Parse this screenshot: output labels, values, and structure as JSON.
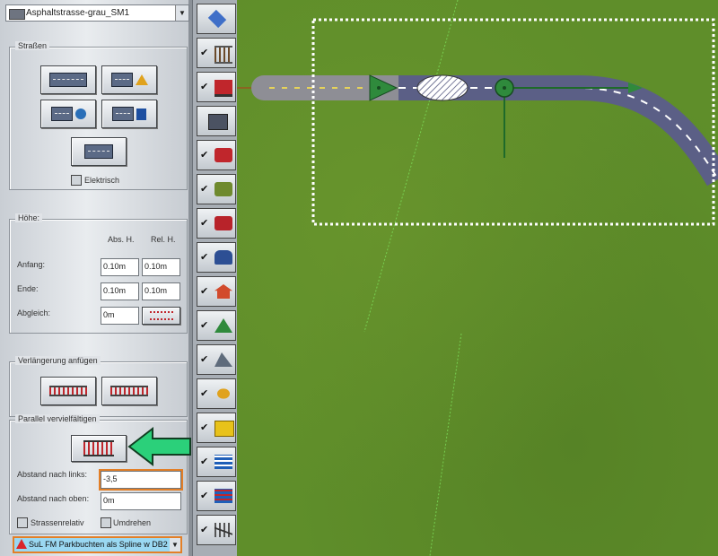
{
  "top_combo": {
    "value": "Asphaltstrasse-grau_SM1"
  },
  "strassen": {
    "title": "Straßen",
    "elektrisch_label": "Elektrisch"
  },
  "hoehe": {
    "title": "Höhe:",
    "col_abs": "Abs. H.",
    "col_rel": "Rel. H.",
    "rows": [
      {
        "label": "Anfang:",
        "abs": "0.10m",
        "rel": "0.10m"
      },
      {
        "label": "Ende:",
        "abs": "0.10m",
        "rel": "0.10m"
      },
      {
        "label": "Abgleich:",
        "abs": "0m"
      }
    ]
  },
  "verlaengerung": {
    "title": "Verlängerung anfügen"
  },
  "parallel": {
    "title": "Parallel vervielfältigen",
    "links_label": "Abstand nach links:",
    "links_value": "-3,5",
    "oben_label": "Abstand nach oben:",
    "oben_value": "0m",
    "strassenrelativ_label": "Strassenrelativ",
    "umdrehen_label": "Umdrehen"
  },
  "bottom_combo": {
    "value": "SuL FM Parkbuchten als Spline w DB2"
  },
  "strip_buttons": [
    {
      "icon": "cube-icon",
      "checked": false
    },
    {
      "icon": "rails-icon",
      "checked": true
    },
    {
      "icon": "train-icon",
      "checked": true
    },
    {
      "icon": "road-icon",
      "checked": false
    },
    {
      "icon": "red-car-icon",
      "checked": true
    },
    {
      "icon": "green-signal-icon",
      "checked": true
    },
    {
      "icon": "red-signal-icon",
      "checked": true
    },
    {
      "icon": "people-icon",
      "checked": true
    },
    {
      "icon": "house-icon",
      "checked": true
    },
    {
      "icon": "tree-icon",
      "checked": true
    },
    {
      "icon": "mountain-icon",
      "checked": true
    },
    {
      "icon": "flower-icon",
      "checked": true
    },
    {
      "icon": "yellow-box-icon",
      "checked": true
    },
    {
      "icon": "water-icon",
      "checked": true
    },
    {
      "icon": "water-signal-icon",
      "checked": true
    },
    {
      "icon": "track-switch-icon",
      "checked": true
    }
  ],
  "colors": {
    "grass": "#5f8e2a",
    "road": "#5b5f86",
    "accent_orange": "#e37f27",
    "arrow_green": "#2bd07a"
  }
}
